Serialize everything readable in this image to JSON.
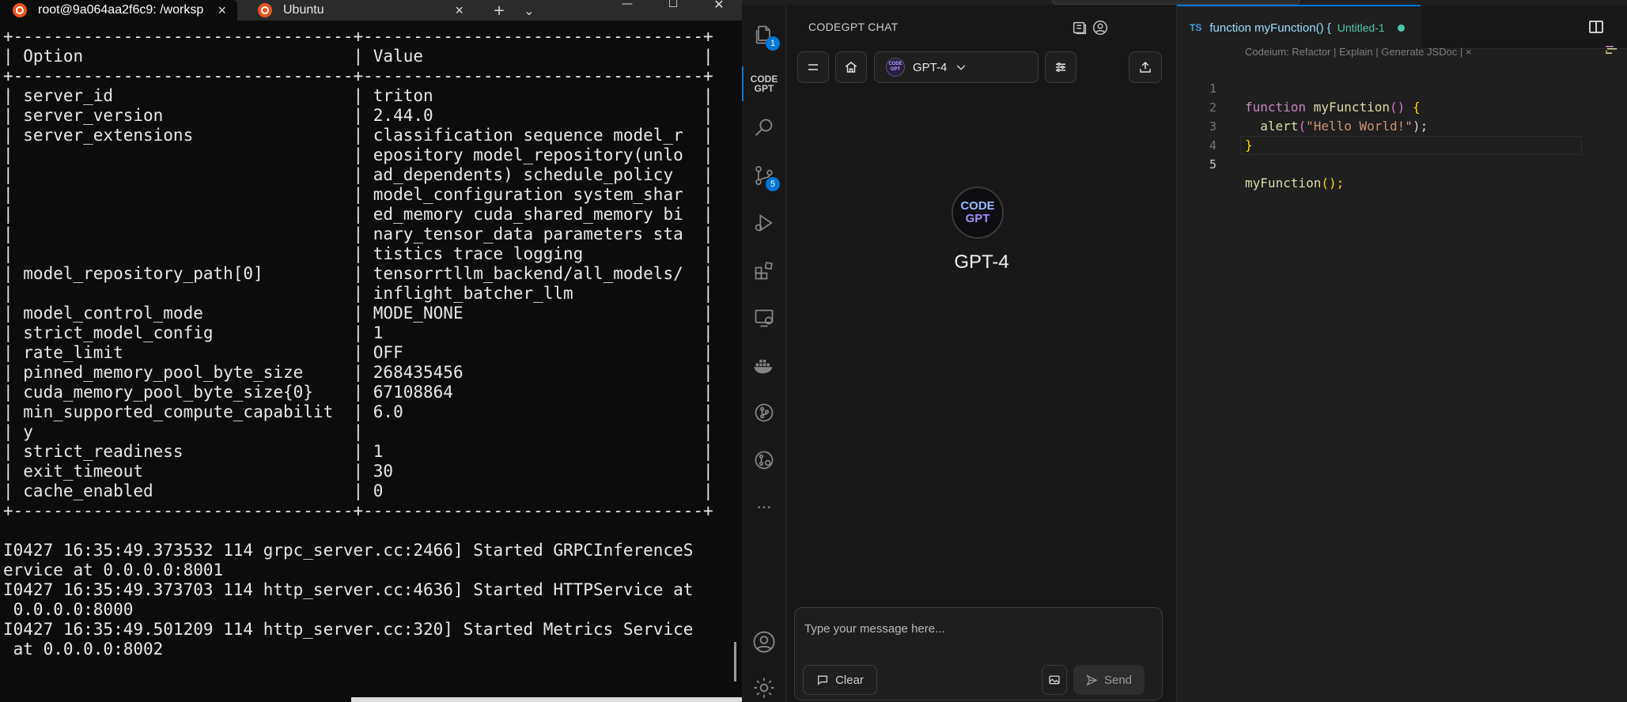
{
  "terminal": {
    "tabs": [
      {
        "label": "root@9a064aa2f6c9: /worksp",
        "close": "×"
      },
      {
        "label": "Ubuntu",
        "close": "×"
      }
    ],
    "new_tab": "+",
    "dropdown": "⌄",
    "window_controls": {
      "minimize": "—",
      "maximize": "☐",
      "close": "✕"
    },
    "lines": [
      "+----------------------------------+----------------------------------+",
      "| Option                           | Value                            |",
      "+----------------------------------+----------------------------------+",
      "| server_id                        | triton                           |",
      "| server_version                   | 2.44.0                           |",
      "| server_extensions                | classification sequence model_r  |",
      "|                                  | epository model_repository(unlo  |",
      "|                                  | ad_dependents) schedule_policy   |",
      "|                                  | model_configuration system_shar  |",
      "|                                  | ed_memory cuda_shared_memory bi  |",
      "|                                  | nary_tensor_data parameters sta  |",
      "|                                  | tistics trace logging            |",
      "| model_repository_path[0]         | tensorrtllm_backend/all_models/  |",
      "|                                  | inflight_batcher_llm             |",
      "| model_control_mode               | MODE_NONE                        |",
      "| strict_model_config              | 1                                |",
      "| rate_limit                       | OFF                              |",
      "| pinned_memory_pool_byte_size     | 268435456                        |",
      "| cuda_memory_pool_byte_size{0}    | 67108864                         |",
      "| min_supported_compute_capabilit  | 6.0                              |",
      "| y                                |                                  |",
      "| strict_readiness                 | 1                                |",
      "| exit_timeout                     | 30                               |",
      "| cache_enabled                    | 0                                |",
      "+----------------------------------+----------------------------------+",
      "",
      "I0427 16:35:49.373532 114 grpc_server.cc:2466] Started GRPCInferenceS",
      "ervice at 0.0.0.0:8001",
      "I0427 16:35:49.373703 114 http_server.cc:4636] Started HTTPService at",
      " 0.0.0.0:8000",
      "I0427 16:35:49.501209 114 http_server.cc:320] Started Metrics Service",
      " at 0.0.0.0:8002"
    ]
  },
  "activity_bar": {
    "explorer_badge": "1",
    "codegpt_label_1": "CODE",
    "codegpt_label_2": "GPT",
    "scm_badge": "5",
    "more": "···"
  },
  "sidebar": {
    "title": "CODEGPT CHAT",
    "model": "GPT-4",
    "center_logo_1": "CODE",
    "center_logo_2": "GPT",
    "center_model": "GPT-4",
    "input_placeholder": "Type your message here...",
    "clear_label": "Clear",
    "send_label": "Send"
  },
  "editor": {
    "tab_lang": "TS",
    "tab_title": "function myFunction() {",
    "tab_file": "Untitled-1",
    "codelens": "Codeium: Refactor | Explain | Generate JSDoc | ×",
    "line_numbers": [
      "1",
      "2",
      "3",
      "4",
      "5"
    ],
    "code": {
      "l1_kw": "function",
      "l1_fn": "myFunction",
      "l1_paren": "()",
      "l1_brace": "{",
      "l2_fn": "alert",
      "l2_open": "(",
      "l2_str": "\"Hello World!\"",
      "l2_close": ");",
      "l3_brace": "}",
      "l5_fn": "myFunction",
      "l5_end": "();"
    }
  },
  "colors": {
    "accent": "#0078d4",
    "terminal_bg": "#0c0c0c",
    "ubuntu": "#e95420"
  }
}
